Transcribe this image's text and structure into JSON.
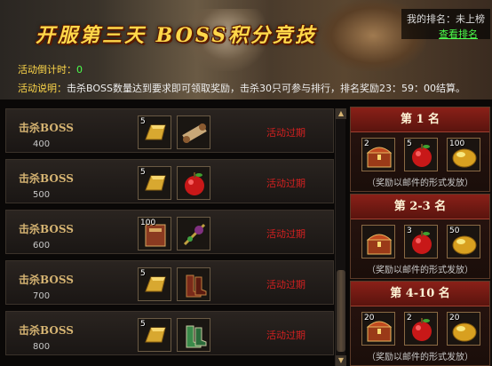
{
  "header": {
    "title": "开服第三天 BOSS积分竞技",
    "my_rank_label": "我的排名：未上榜",
    "view_rank": "查看排名",
    "countdown_label": "活动倒计时：",
    "countdown_value": "0",
    "desc_label": "活动说明：",
    "desc_text": "击杀BOSS数量达到要求即可领取奖励，击杀30只可参与排行，排名奖励23：59：00结算。"
  },
  "tasks": [
    {
      "label": "击杀BOSS",
      "count": "400",
      "status": "活动过期",
      "items": [
        {
          "icon": "gold-bar-icon",
          "qty": "5"
        },
        {
          "icon": "scroll-icon",
          "qty": ""
        }
      ]
    },
    {
      "label": "击杀BOSS",
      "count": "500",
      "status": "活动过期",
      "items": [
        {
          "icon": "gold-bar-icon",
          "qty": "5"
        },
        {
          "icon": "apple-icon",
          "qty": ""
        }
      ]
    },
    {
      "label": "击杀BOSS",
      "count": "600",
      "status": "活动过期",
      "items": [
        {
          "icon": "book-icon",
          "qty": "100"
        },
        {
          "icon": "weapon-icon",
          "qty": ""
        }
      ]
    },
    {
      "label": "击杀BOSS",
      "count": "700",
      "status": "活动过期",
      "items": [
        {
          "icon": "gold-bar-icon",
          "qty": "5"
        },
        {
          "icon": "boots-icon",
          "qty": ""
        }
      ]
    },
    {
      "label": "击杀BOSS",
      "count": "800",
      "status": "活动过期",
      "items": [
        {
          "icon": "gold-bar-icon",
          "qty": "5"
        },
        {
          "icon": "green-boots-icon",
          "qty": ""
        }
      ]
    }
  ],
  "rank_rewards": [
    {
      "title": "第 1 名",
      "note": "（奖励以邮件的形式发放）",
      "items": [
        {
          "icon": "chest-icon",
          "qty": "2"
        },
        {
          "icon": "apple-icon",
          "qty": "5"
        },
        {
          "icon": "gold-orb-icon",
          "qty": "100"
        }
      ]
    },
    {
      "title": "第 2-3 名",
      "note": "（奖励以邮件的形式发放）",
      "items": [
        {
          "icon": "chest-icon",
          "qty": ""
        },
        {
          "icon": "apple-icon",
          "qty": "3"
        },
        {
          "icon": "gold-orb-icon",
          "qty": "50"
        }
      ]
    },
    {
      "title": "第 4-10 名",
      "note": "（奖励以邮件的形式发放）",
      "items": [
        {
          "icon": "chest-icon",
          "qty": "20"
        },
        {
          "icon": "apple-icon",
          "qty": "2"
        },
        {
          "icon": "gold-orb-icon",
          "qty": "20"
        }
      ]
    }
  ],
  "scrollbar": {
    "up": "▲",
    "down": "▼"
  }
}
